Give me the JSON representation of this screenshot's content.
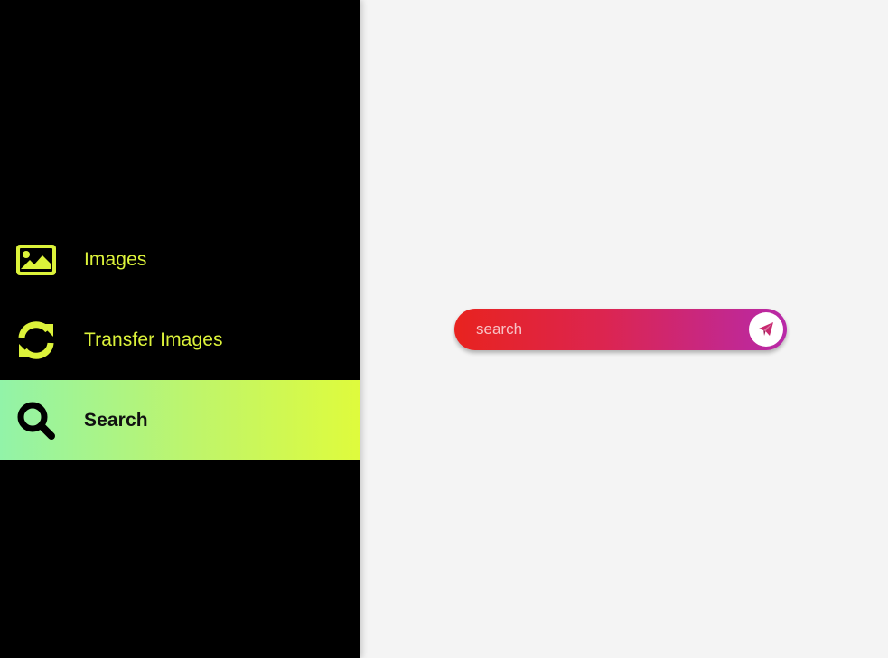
{
  "sidebar": {
    "items": [
      {
        "label": "Images",
        "icon": "image-icon",
        "active": false
      },
      {
        "label": "Transfer Images",
        "icon": "refresh-icon",
        "active": false
      },
      {
        "label": "Search",
        "icon": "search-icon",
        "active": true
      }
    ]
  },
  "search": {
    "placeholder": "search",
    "value": "",
    "submit_icon": "paper-plane-icon"
  },
  "colors": {
    "sidebar_bg": "#000000",
    "accent_text": "#dcf23a",
    "active_gradient": [
      "#92f3a8",
      "#dffb3c"
    ],
    "search_gradient": [
      "#e8231f",
      "#b829a8"
    ],
    "page_bg": "#f4f4f4"
  }
}
